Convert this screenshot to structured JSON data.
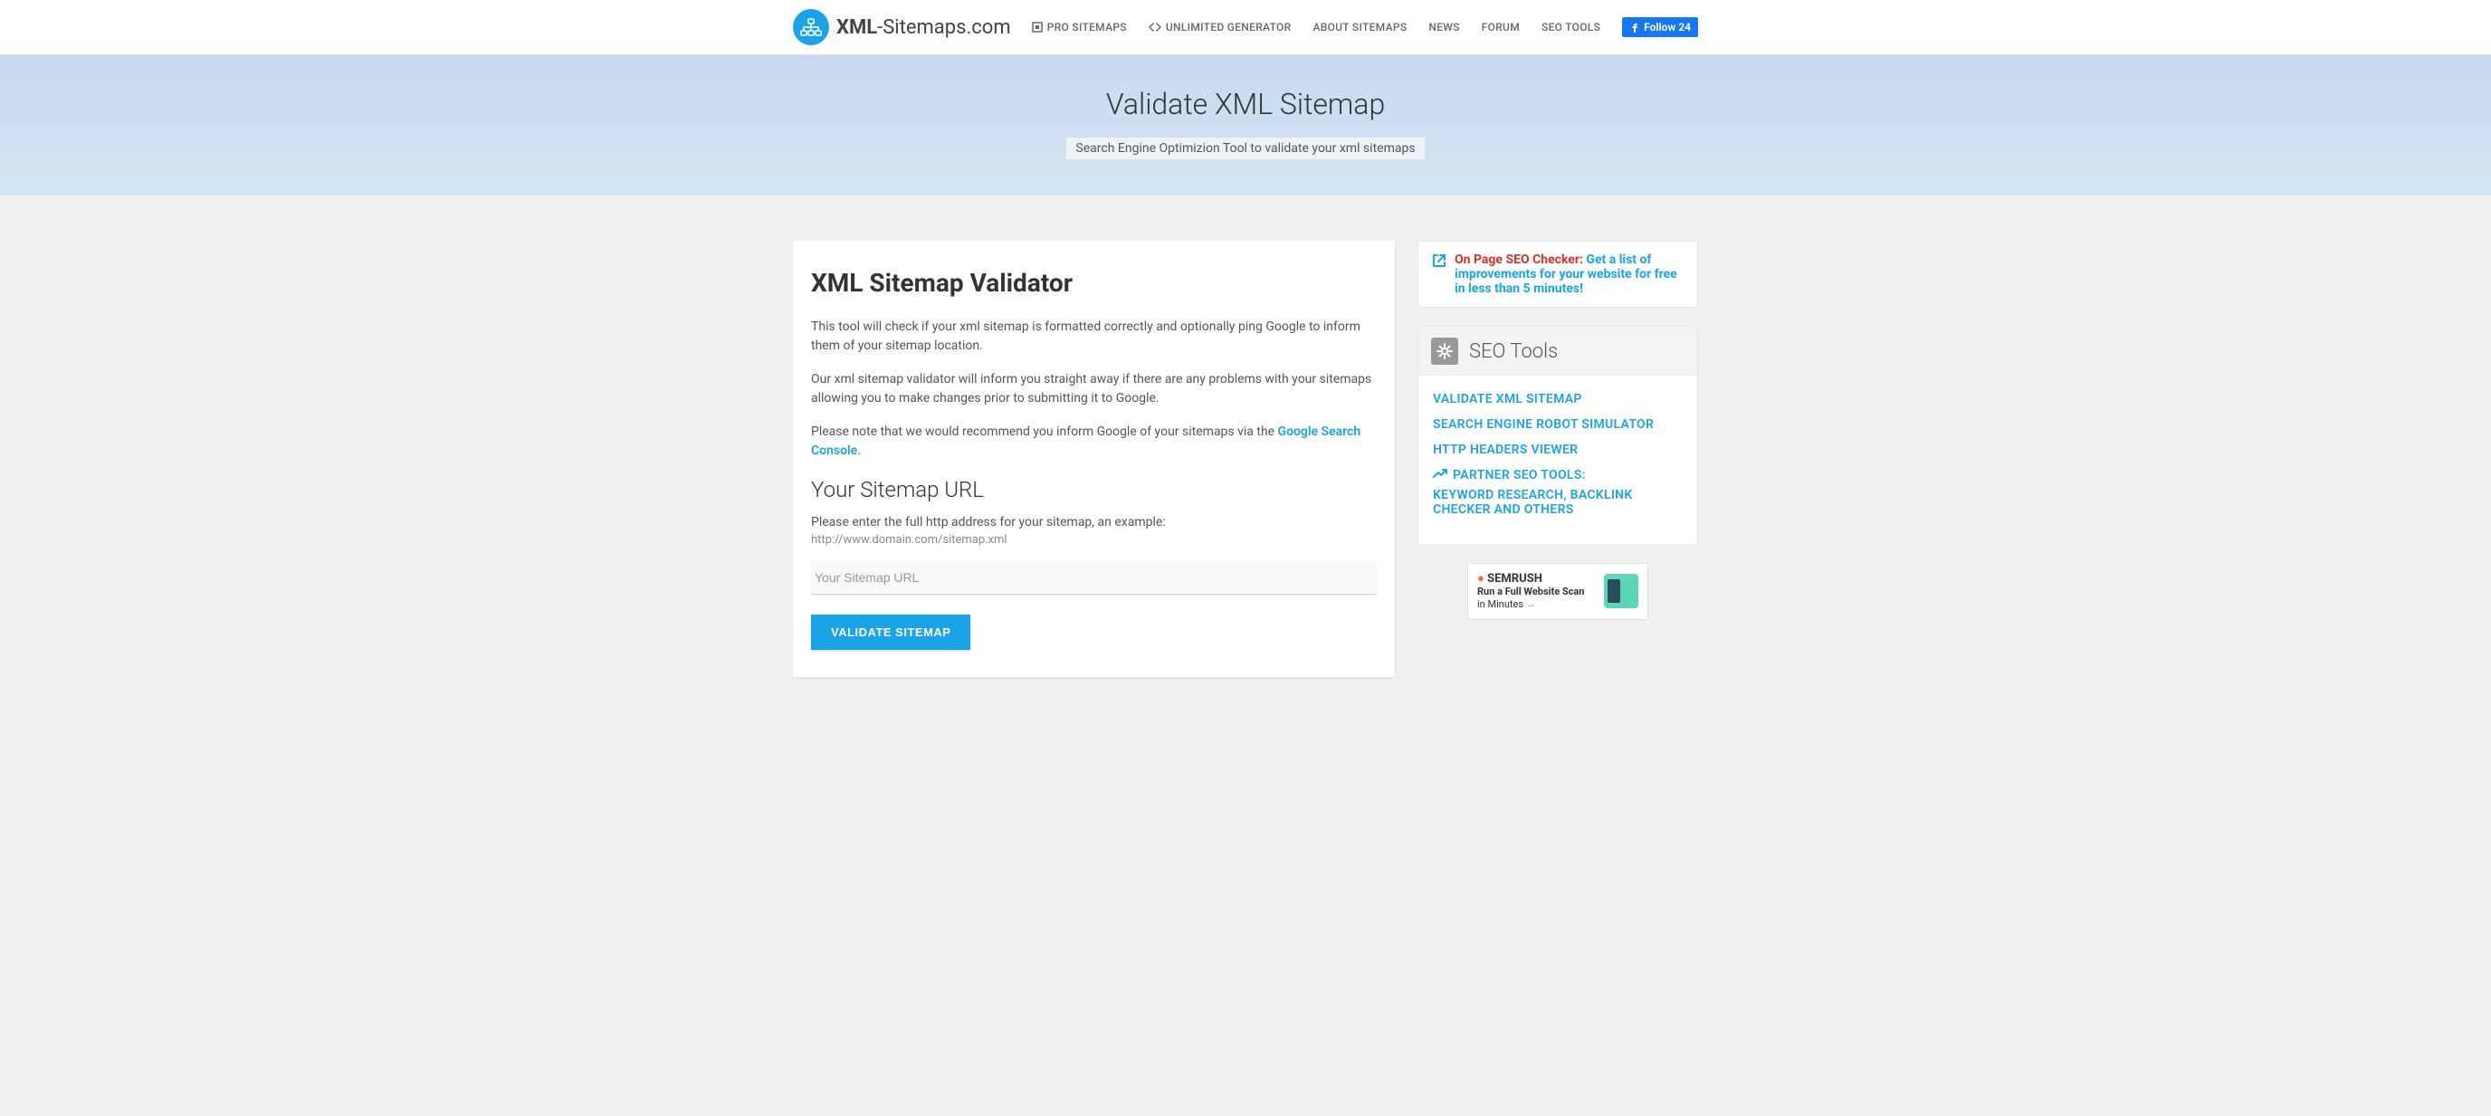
{
  "header": {
    "logo_bold": "XML",
    "logo_rest": "-Sitemaps.com",
    "nav": [
      {
        "label": "PRO SITEMAPS",
        "icon": "square"
      },
      {
        "label": "UNLIMITED GENERATOR",
        "icon": "code"
      },
      {
        "label": "ABOUT SITEMAPS",
        "icon": ""
      },
      {
        "label": "NEWS",
        "icon": ""
      },
      {
        "label": "FORUM",
        "icon": ""
      },
      {
        "label": "SEO TOOLS",
        "icon": ""
      }
    ],
    "fb_label": "Follow 24"
  },
  "hero": {
    "title": "Validate XML Sitemap",
    "subtitle": "Search Engine Optimizion Tool to validate your xml sitemaps"
  },
  "main": {
    "title": "XML Sitemap Validator",
    "para1": "This tool will check if your xml sitemap is formatted correctly and optionally ping Google to inform them of your sitemap location.",
    "para2": "Our xml sitemap validator will inform you straight away if there are any problems with your sitemaps allowing you to make changes prior to submitting it to Google.",
    "para3_prefix": "Please note that we would recommend you inform Google of your sitemaps via the ",
    "para3_link": "Google Search Console",
    "para3_suffix": ".",
    "subheading": "Your Sitemap URL",
    "label": "Please enter the full http address for your sitemap, an example:",
    "example": "http://www.domain.com/sitemap.xml",
    "input_placeholder": "Your Sitemap URL",
    "button": "VALIDATE SITEMAP"
  },
  "sidebar": {
    "promo": {
      "red": "On Page SEO Checker:",
      "blue": "Get a list of improvements for your website for free in less than 5 minutes!"
    },
    "tools_header": "SEO Tools",
    "tools_links": [
      "VALIDATE XML SITEMAP",
      "SEARCH ENGINE ROBOT SIMULATOR",
      "HTTP HEADERS VIEWER"
    ],
    "partner_label": "PARTNER SEO TOOLS:",
    "partner_sub": "KEYWORD RESEARCH, BACKLINK CHECKER AND OTHERS",
    "semrush": {
      "logo": "SEMRUSH",
      "line1": "Run a Full Website Scan",
      "line2": "in Minutes"
    }
  }
}
